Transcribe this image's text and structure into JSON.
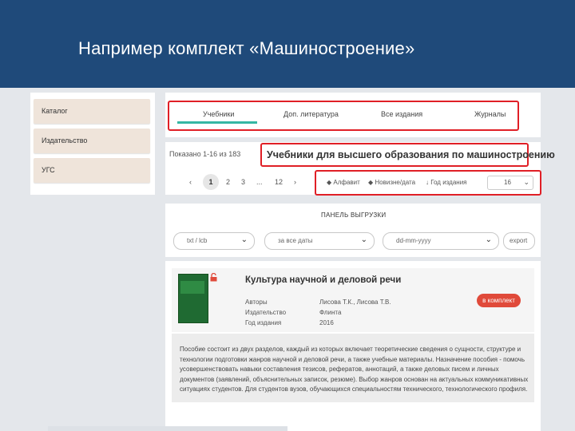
{
  "slide": {
    "title": "Например комплект «Машиностроение»"
  },
  "facets": [
    "Каталог",
    "Издательство",
    "УГС"
  ],
  "tabs": [
    "Учебники",
    "Доп. литература",
    "Все издания",
    "Журналы"
  ],
  "listing": {
    "shown": "Показано 1-16 из 183",
    "title": "Учебники для высшего образования по машиностроению",
    "pagination": {
      "prev": "‹",
      "pages": [
        "1",
        "2",
        "3",
        "...",
        "12"
      ],
      "next": "›",
      "current": "1"
    },
    "sort": [
      "Алфавит",
      "Новизне/дата",
      "Год издания"
    ],
    "per_page": "16"
  },
  "export": {
    "title": "ПАНЕЛЬ ВЫГРУЗКИ",
    "format": "txt / lcb",
    "range": "за все даты",
    "date_placeholder": "dd-mm-yyyy",
    "button": "export"
  },
  "book": {
    "title": "Культура научной и деловой речи",
    "meta": [
      {
        "label": "Авторы",
        "value": "Лисова Т.К., Лисова Т.В."
      },
      {
        "label": "Издательство",
        "value": "Флинта"
      },
      {
        "label": "Год издания",
        "value": "2016"
      }
    ],
    "add_button": "в комплект",
    "description": "Пособие состоит из двух разделов, каждый из которых включает теоретические сведения о сущности, структуре и технологии подготовки жанров научной и деловой речи, а также учебные материалы. Назначение пособия - помочь усовершенствовать навыки составления тезисов, рефератов, аннотаций, а также деловых писем и личных документов (заявлений, объяснительных записок, резюме). Выбор жанров основан на актуальных коммуникативных ситуациях студентов. Для студентов вузов, обучающихся специальностям технического, технологического профиля."
  },
  "colors": {
    "header": "#1f4a7a",
    "highlight": "#e01f26",
    "tab_active": "#35b7a3",
    "accent_button": "#e04a3a"
  }
}
